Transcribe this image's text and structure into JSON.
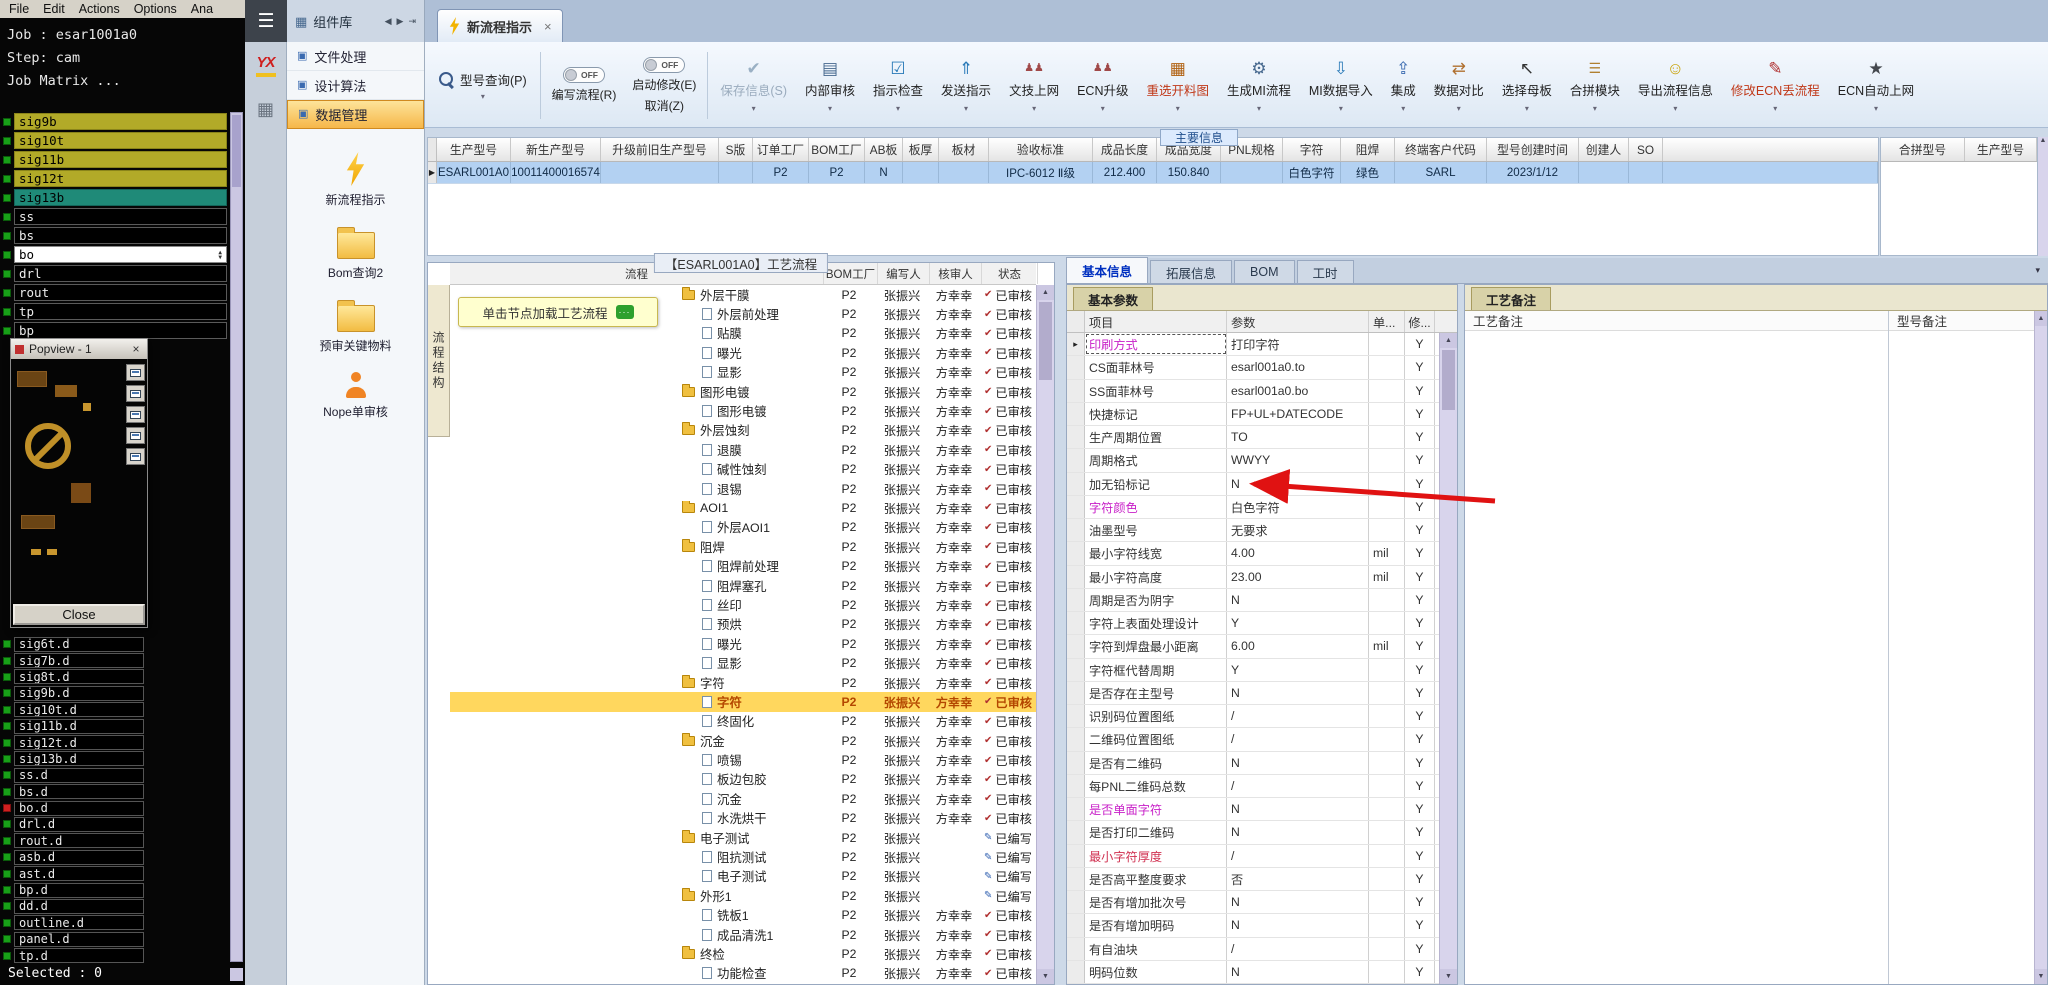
{
  "colors": {
    "toolbar_accent_text": "#c03818",
    "selected_row": "#b3d1f2",
    "tree_highlight": "#ffd75e",
    "nav_active": "#f5b84a",
    "annotation_arrow": "#e01212"
  },
  "cam_panel": {
    "menu_items": [
      "File",
      "Edit",
      "Actions",
      "Options",
      "Ana"
    ],
    "job_label": "Job : esar1001a0",
    "step_label": "Step: cam",
    "matrix_label": "Job Matrix ...",
    "layers_top": [
      {
        "name": "sig9b",
        "style": "yellow"
      },
      {
        "name": "sig10t",
        "style": "yellow"
      },
      {
        "name": "sig11b",
        "style": "yellow"
      },
      {
        "name": "sig12t",
        "style": "yellow"
      },
      {
        "name": "sig13b",
        "style": "teal"
      },
      {
        "name": "ss",
        "style": "dark"
      },
      {
        "name": "bs",
        "style": "dark"
      },
      {
        "name": "bo",
        "style": "active"
      },
      {
        "name": "drl",
        "style": "dark"
      },
      {
        "name": "rout",
        "style": "dark"
      },
      {
        "name": "tp",
        "style": "dark"
      },
      {
        "name": "bp",
        "style": "dark"
      }
    ],
    "layers_bottom": [
      {
        "name": "sig6t.d",
        "indicator": "green"
      },
      {
        "name": "sig7b.d",
        "indicator": "green"
      },
      {
        "name": "sig8t.d",
        "indicator": "green"
      },
      {
        "name": "sig9b.d",
        "indicator": "green"
      },
      {
        "name": "sig10t.d",
        "indicator": "green"
      },
      {
        "name": "sig11b.d",
        "indicator": "green"
      },
      {
        "name": "sig12t.d",
        "indicator": "green"
      },
      {
        "name": "sig13b.d",
        "indicator": "green"
      },
      {
        "name": "ss.d",
        "indicator": "green"
      },
      {
        "name": "bs.d",
        "indicator": "green"
      },
      {
        "name": "bo.d",
        "indicator": "red"
      },
      {
        "name": "drl.d",
        "indicator": "green"
      },
      {
        "name": "rout.d",
        "indicator": "green"
      },
      {
        "name": "asb.d",
        "indicator": "green"
      },
      {
        "name": "ast.d",
        "indicator": "green"
      },
      {
        "name": "bp.d",
        "indicator": "green"
      },
      {
        "name": "dd.d",
        "indicator": "green"
      },
      {
        "name": "outline.d",
        "indicator": "green"
      },
      {
        "name": "panel.d",
        "indicator": "green"
      },
      {
        "name": "tp.d",
        "indicator": "green"
      }
    ],
    "selected_label": "Selected : 0",
    "popview": {
      "title": "Popview - 1",
      "close_x": "×",
      "close_button": "Close",
      "tools": [
        "window-icon",
        "window-icon",
        "window-icon",
        "window-icon",
        "window-icon"
      ]
    }
  },
  "titlebar": {
    "component_tab": "组件库",
    "document_tab": "新流程指示",
    "close_x": "×"
  },
  "sidebar": {
    "logo_text": "YX",
    "sections": [
      {
        "label": "文件处理",
        "active": false
      },
      {
        "label": "设计算法",
        "active": false
      },
      {
        "label": "数据管理",
        "active": true
      }
    ],
    "modules": [
      {
        "label": "新流程指示",
        "icon": "lightning-icon"
      },
      {
        "label": "Bom查询2",
        "icon": "folder-icon"
      },
      {
        "label": "预审关键物料",
        "icon": "folder-icon"
      },
      {
        "label": "Nope单审核",
        "icon": "person-icon"
      }
    ]
  },
  "toolbar": {
    "query_button": {
      "label": "型号查询(P)",
      "icon": "search-icon"
    },
    "toggle_groups": [
      {
        "state": "OFF",
        "label": "编写流程(R)"
      },
      {
        "state": "OFF",
        "label": "启动修改(E)",
        "label2": "取消(Z)"
      }
    ],
    "buttons": [
      {
        "label": "保存信息(S)",
        "icon": "save-icon",
        "disabled": true
      },
      {
        "label": "内部审核",
        "icon": "printer-icon"
      },
      {
        "label": "指示检查",
        "icon": "check-square-icon"
      },
      {
        "label": "发送指示",
        "icon": "send-up-icon"
      },
      {
        "label": "文技上网",
        "icon": "users-icon"
      },
      {
        "label": "ECN升级",
        "icon": "users-icon"
      },
      {
        "label": "重选开料图",
        "icon": "board-icon",
        "accent": true
      },
      {
        "label": "生成MI流程",
        "icon": "gear-icon"
      },
      {
        "label": "MI数据导入",
        "icon": "import-down-icon"
      },
      {
        "label": "集成",
        "icon": "integrate-icon"
      },
      {
        "label": "数据对比",
        "icon": "compare-icon"
      },
      {
        "label": "选择母板",
        "icon": "cursor-icon"
      },
      {
        "label": "合拼模块",
        "icon": "list-icon"
      },
      {
        "label": "导出流程信息",
        "icon": "smiley-icon"
      },
      {
        "label": "修改ECN丢流程",
        "icon": "edit-icon",
        "accent": true
      },
      {
        "label": "ECN自动上网",
        "icon": "star-icon"
      }
    ]
  },
  "main_grid": {
    "section_label": "主要信息",
    "columns": [
      "生产型号",
      "新生产型号",
      "升级前旧生产型号",
      "S版",
      "订单工厂",
      "BOM工厂",
      "AB板",
      "板厚",
      "板材",
      "验收标准",
      "成品长度",
      "成品宽度",
      "PNL规格",
      "字符",
      "阻焊",
      "终端客户代码",
      "型号创建时间",
      "创建人",
      "SO"
    ],
    "row": [
      "ESARL001A0",
      "10011400016574",
      "",
      "",
      "P2",
      "P2",
      "N",
      "",
      "",
      "IPC-6012 Ⅱ级",
      "212.400",
      "150.840",
      "",
      "白色字符",
      "绿色",
      "SARL",
      "2023/1/12",
      "",
      ""
    ],
    "right_columns": [
      "合拼型号",
      "生产型号"
    ]
  },
  "process_tree": {
    "title": "【ESARL001A0】工艺流程",
    "side_tab": "流程结构",
    "hint_bubble": "单击节点加载工艺流程",
    "columns": [
      "流程",
      "BOM工厂",
      "编写人",
      "核审人",
      "状态"
    ],
    "rows": [
      {
        "name": "外层干膜",
        "level": 0,
        "factory": "P2",
        "writer": "张振兴",
        "auditor": "方幸幸",
        "status": "已审核"
      },
      {
        "name": "外层前处理",
        "level": 1,
        "factory": "P2",
        "writer": "张振兴",
        "auditor": "方幸幸",
        "status": "已审核"
      },
      {
        "name": "贴膜",
        "level": 1,
        "factory": "P2",
        "writer": "张振兴",
        "auditor": "方幸幸",
        "status": "已审核"
      },
      {
        "name": "曝光",
        "level": 1,
        "factory": "P2",
        "writer": "张振兴",
        "auditor": "方幸幸",
        "status": "已审核"
      },
      {
        "name": "显影",
        "level": 1,
        "factory": "P2",
        "writer": "张振兴",
        "auditor": "方幸幸",
        "status": "已审核"
      },
      {
        "name": "图形电镀",
        "level": 0,
        "factory": "P2",
        "writer": "张振兴",
        "auditor": "方幸幸",
        "status": "已审核"
      },
      {
        "name": "图形电镀",
        "level": 1,
        "factory": "P2",
        "writer": "张振兴",
        "auditor": "方幸幸",
        "status": "已审核"
      },
      {
        "name": "外层蚀刻",
        "level": 0,
        "factory": "P2",
        "writer": "张振兴",
        "auditor": "方幸幸",
        "status": "已审核"
      },
      {
        "name": "退膜",
        "level": 1,
        "factory": "P2",
        "writer": "张振兴",
        "auditor": "方幸幸",
        "status": "已审核"
      },
      {
        "name": "碱性蚀刻",
        "level": 1,
        "factory": "P2",
        "writer": "张振兴",
        "auditor": "方幸幸",
        "status": "已审核"
      },
      {
        "name": "退锡",
        "level": 1,
        "factory": "P2",
        "writer": "张振兴",
        "auditor": "方幸幸",
        "status": "已审核"
      },
      {
        "name": "AOI1",
        "level": 0,
        "factory": "P2",
        "writer": "张振兴",
        "auditor": "方幸幸",
        "status": "已审核"
      },
      {
        "name": "外层AOI1",
        "level": 1,
        "factory": "P2",
        "writer": "张振兴",
        "auditor": "方幸幸",
        "status": "已审核"
      },
      {
        "name": "阻焊",
        "level": 0,
        "factory": "P2",
        "writer": "张振兴",
        "auditor": "方幸幸",
        "status": "已审核"
      },
      {
        "name": "阻焊前处理",
        "level": 1,
        "factory": "P2",
        "writer": "张振兴",
        "auditor": "方幸幸",
        "status": "已审核"
      },
      {
        "name": "阻焊塞孔",
        "level": 1,
        "factory": "P2",
        "writer": "张振兴",
        "auditor": "方幸幸",
        "status": "已审核"
      },
      {
        "name": "丝印",
        "level": 1,
        "factory": "P2",
        "writer": "张振兴",
        "auditor": "方幸幸",
        "status": "已审核"
      },
      {
        "name": "预烘",
        "level": 1,
        "factory": "P2",
        "writer": "张振兴",
        "auditor": "方幸幸",
        "status": "已审核"
      },
      {
        "name": "曝光",
        "level": 1,
        "factory": "P2",
        "writer": "张振兴",
        "auditor": "方幸幸",
        "status": "已审核"
      },
      {
        "name": "显影",
        "level": 1,
        "factory": "P2",
        "writer": "张振兴",
        "auditor": "方幸幸",
        "status": "已审核"
      },
      {
        "name": "字符",
        "level": 0,
        "factory": "P2",
        "writer": "张振兴",
        "auditor": "方幸幸",
        "status": "已审核"
      },
      {
        "name": "字符",
        "level": 1,
        "factory": "P2",
        "writer": "张振兴",
        "auditor": "方幸幸",
        "status": "已审核",
        "highlight": true
      },
      {
        "name": "终固化",
        "level": 1,
        "factory": "P2",
        "writer": "张振兴",
        "auditor": "方幸幸",
        "status": "已审核"
      },
      {
        "name": "沉金",
        "level": 0,
        "factory": "P2",
        "writer": "张振兴",
        "auditor": "方幸幸",
        "status": "已审核"
      },
      {
        "name": "喷锡",
        "level": 1,
        "factory": "P2",
        "writer": "张振兴",
        "auditor": "方幸幸",
        "status": "已审核"
      },
      {
        "name": "板边包胶",
        "level": 1,
        "factory": "P2",
        "writer": "张振兴",
        "auditor": "方幸幸",
        "status": "已审核"
      },
      {
        "name": "沉金",
        "level": 1,
        "factory": "P2",
        "writer": "张振兴",
        "auditor": "方幸幸",
        "status": "已审核"
      },
      {
        "name": "水洗烘干",
        "level": 1,
        "factory": "P2",
        "writer": "张振兴",
        "auditor": "方幸幸",
        "status": "已审核"
      },
      {
        "name": "电子测试",
        "level": 0,
        "factory": "P2",
        "writer": "张振兴",
        "auditor": "",
        "status": "已编写"
      },
      {
        "name": "阻抗测试",
        "level": 1,
        "factory": "P2",
        "writer": "张振兴",
        "auditor": "",
        "status": "已编写"
      },
      {
        "name": "电子测试",
        "level": 1,
        "factory": "P2",
        "writer": "张振兴",
        "auditor": "",
        "status": "已编写"
      },
      {
        "name": "外形1",
        "level": 0,
        "factory": "P2",
        "writer": "张振兴",
        "auditor": "",
        "status": "已编写"
      },
      {
        "name": "铣板1",
        "level": 1,
        "factory": "P2",
        "writer": "张振兴",
        "auditor": "方幸幸",
        "status": "已审核"
      },
      {
        "name": "成品清洗1",
        "level": 1,
        "factory": "P2",
        "writer": "张振兴",
        "auditor": "方幸幸",
        "status": "已审核"
      },
      {
        "name": "终检",
        "level": 0,
        "factory": "P2",
        "writer": "张振兴",
        "auditor": "方幸幸",
        "status": "已审核"
      },
      {
        "name": "功能检查",
        "level": 1,
        "factory": "P2",
        "writer": "张振兴",
        "auditor": "方幸幸",
        "status": "已审核"
      }
    ]
  },
  "basic_info": {
    "tabs": [
      {
        "label": "基本信息",
        "active": true
      },
      {
        "label": "拓展信息",
        "active": false
      },
      {
        "label": "BOM",
        "active": false
      },
      {
        "label": "工时",
        "active": false
      }
    ],
    "sub_tab": "基本参数",
    "columns": [
      "项目",
      "参数",
      "单...",
      "修..."
    ],
    "rows": [
      {
        "item": "印刷方式",
        "value": "打印字符",
        "unit": "",
        "mod": "Y",
        "accent": "magenta",
        "selected": true
      },
      {
        "item": "CS面菲林号",
        "value": "esarl001a0.to",
        "unit": "",
        "mod": "Y"
      },
      {
        "item": "SS面菲林号",
        "value": "esarl001a0.bo",
        "unit": "",
        "mod": "Y"
      },
      {
        "item": "快捷标记",
        "value": "FP+UL+DATECODE",
        "unit": "",
        "mod": "Y"
      },
      {
        "item": "生产周期位置",
        "value": "TO",
        "unit": "",
        "mod": "Y"
      },
      {
        "item": "周期格式",
        "value": "WWYY",
        "unit": "",
        "mod": "Y"
      },
      {
        "item": "加无铅标记",
        "value": "N",
        "unit": "",
        "mod": "Y"
      },
      {
        "item": "字符颜色",
        "value": "白色字符",
        "unit": "",
        "mod": "Y",
        "accent": "magenta"
      },
      {
        "item": "油墨型号",
        "value": "无要求",
        "unit": "",
        "mod": "Y"
      },
      {
        "item": "最小字符线宽",
        "value": "4.00",
        "unit": "mil",
        "mod": "Y"
      },
      {
        "item": "最小字符高度",
        "value": "23.00",
        "unit": "mil",
        "mod": "Y"
      },
      {
        "item": "周期是否为阴字",
        "value": "N",
        "unit": "",
        "mod": "Y"
      },
      {
        "item": "字符上表面处理设计",
        "value": "Y",
        "unit": "",
        "mod": "Y"
      },
      {
        "item": "字符到焊盘最小距离",
        "value": "6.00",
        "unit": "mil",
        "mod": "Y"
      },
      {
        "item": "字符框代替周期",
        "value": "Y",
        "unit": "",
        "mod": "Y"
      },
      {
        "item": "是否存在主型号",
        "value": "N",
        "unit": "",
        "mod": "Y"
      },
      {
        "item": "识别码位置图纸",
        "value": "/",
        "unit": "",
        "mod": "Y"
      },
      {
        "item": "二维码位置图纸",
        "value": "/",
        "unit": "",
        "mod": "Y"
      },
      {
        "item": "是否有二维码",
        "value": "N",
        "unit": "",
        "mod": "Y"
      },
      {
        "item": "每PNL二维码总数",
        "value": "/",
        "unit": "",
        "mod": "Y"
      },
      {
        "item": "是否单面字符",
        "value": "N",
        "unit": "",
        "mod": "Y",
        "accent": "magenta"
      },
      {
        "item": "是否打印二维码",
        "value": "N",
        "unit": "",
        "mod": "Y"
      },
      {
        "item": "最小字符厚度",
        "value": "/",
        "unit": "",
        "mod": "Y",
        "accent": "red"
      },
      {
        "item": "是否高平整度要求",
        "value": "否",
        "unit": "",
        "mod": "Y"
      },
      {
        "item": "是否有增加批次号",
        "value": "N",
        "unit": "",
        "mod": "Y"
      },
      {
        "item": "是否有增加明码",
        "value": "N",
        "unit": "",
        "mod": "Y"
      },
      {
        "item": "有自油块",
        "value": "/",
        "unit": "",
        "mod": "Y"
      },
      {
        "item": "明码位数",
        "value": "N",
        "unit": "",
        "mod": "Y"
      }
    ]
  },
  "notes_panel": {
    "tab_label": "工艺备注",
    "columns": [
      "工艺备注",
      "型号备注"
    ]
  },
  "annotation": {
    "type": "arrow",
    "color": "#e01212",
    "points_at": "加无铅标记 value N"
  }
}
